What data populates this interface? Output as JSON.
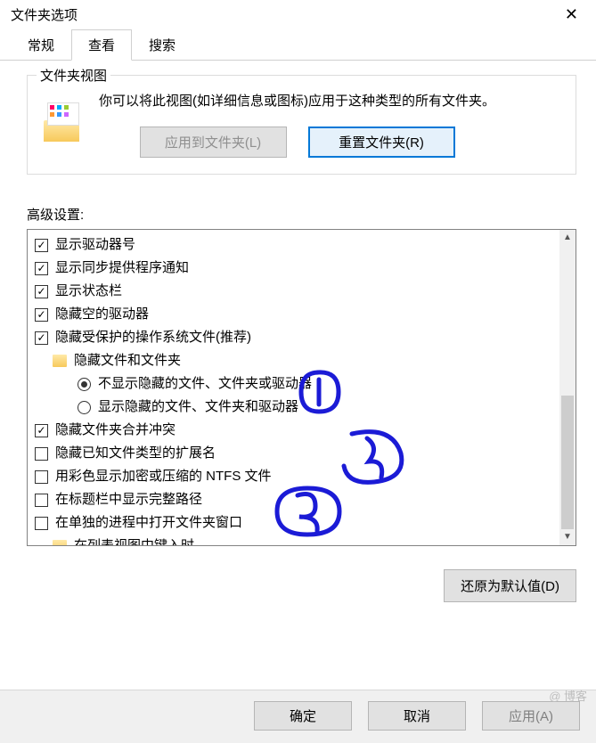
{
  "window": {
    "title": "文件夹选项"
  },
  "tabs": {
    "general": "常规",
    "view": "查看",
    "search": "搜索",
    "active": "view"
  },
  "group": {
    "legend": "文件夹视图",
    "description": "你可以将此视图(如详细信息或图标)应用于这种类型的所有文件夹。",
    "apply_btn": "应用到文件夹(L)",
    "reset_btn": "重置文件夹(R)"
  },
  "advanced": {
    "label": "高级设置:",
    "items": [
      {
        "type": "checkbox",
        "checked": true,
        "text": "显示驱动器号"
      },
      {
        "type": "checkbox",
        "checked": true,
        "text": "显示同步提供程序通知"
      },
      {
        "type": "checkbox",
        "checked": true,
        "text": "显示状态栏"
      },
      {
        "type": "checkbox",
        "checked": true,
        "text": "隐藏空的驱动器"
      },
      {
        "type": "checkbox",
        "checked": true,
        "text": "隐藏受保护的操作系统文件(推荐)"
      },
      {
        "type": "folder",
        "text": "隐藏文件和文件夹"
      },
      {
        "type": "radio",
        "checked": true,
        "text": "不显示隐藏的文件、文件夹或驱动器"
      },
      {
        "type": "radio",
        "checked": false,
        "text": "显示隐藏的文件、文件夹和驱动器"
      },
      {
        "type": "checkbox",
        "checked": true,
        "text": "隐藏文件夹合并冲突"
      },
      {
        "type": "checkbox",
        "checked": false,
        "text": "隐藏已知文件类型的扩展名"
      },
      {
        "type": "checkbox",
        "checked": false,
        "text": "用彩色显示加密或压缩的 NTFS 文件"
      },
      {
        "type": "checkbox",
        "checked": false,
        "text": "在标题栏中显示完整路径"
      },
      {
        "type": "checkbox",
        "checked": false,
        "text": "在单独的进程中打开文件夹窗口"
      },
      {
        "type": "folder",
        "text": "在列表视图中键入时"
      }
    ],
    "restore": "还原为默认值(D)"
  },
  "footer": {
    "ok": "确定",
    "cancel": "取消",
    "apply": "应用(A)"
  },
  "watermark": "@ 博客",
  "annotations": {
    "color": "#1b1bd6"
  }
}
